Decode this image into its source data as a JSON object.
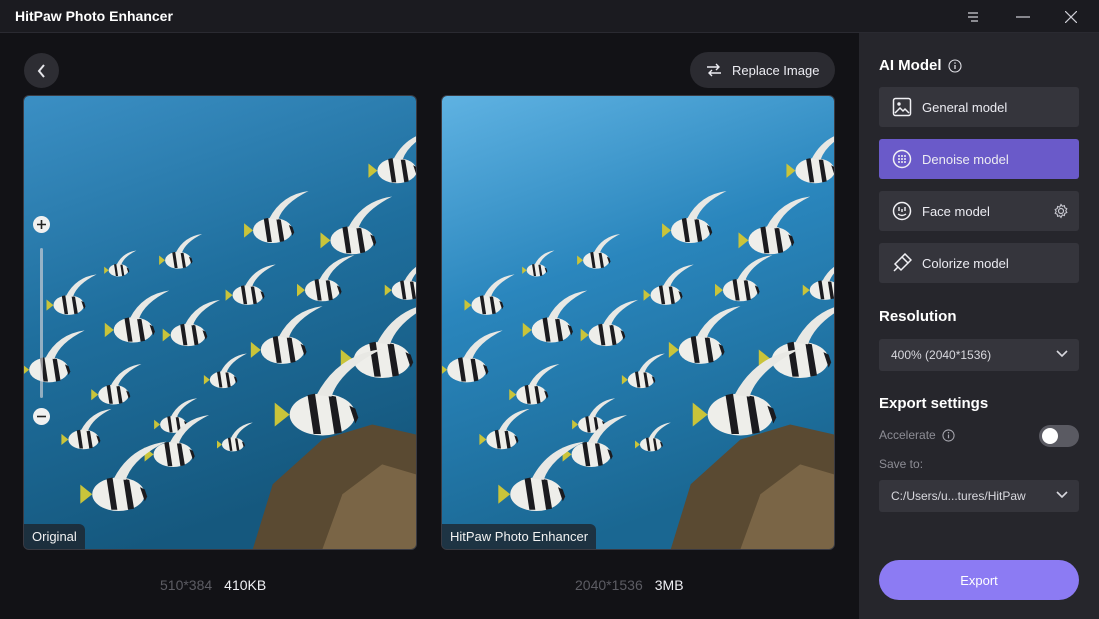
{
  "app": {
    "title": "HitPaw Photo Enhancer"
  },
  "toolbar": {
    "replace_label": "Replace Image"
  },
  "panels": {
    "left": {
      "label": "Original",
      "dimensions": "510*384",
      "size": "410KB"
    },
    "right": {
      "label": "HitPaw Photo Enhancer",
      "dimensions": "2040*1536",
      "size": "3MB"
    }
  },
  "sidebar": {
    "ai_model_title": "AI Model",
    "models": [
      {
        "label": "General model",
        "icon": "image-icon"
      },
      {
        "label": "Denoise model",
        "icon": "denoise-icon",
        "active": true
      },
      {
        "label": "Face model",
        "icon": "face-icon"
      },
      {
        "label": "Colorize model",
        "icon": "colorize-icon"
      }
    ],
    "resolution_title": "Resolution",
    "resolution_value": "400% (2040*1536)",
    "export_settings_title": "Export settings",
    "accelerate_label": "Accelerate",
    "accelerate_on": false,
    "save_to_label": "Save to:",
    "save_path": "C:/Users/u...tures/HitPaw",
    "export_label": "Export"
  },
  "colors": {
    "accent": "#6a5ac9",
    "export": "#8c7bf3",
    "sidebar": "#26262c",
    "background": "#141418"
  }
}
